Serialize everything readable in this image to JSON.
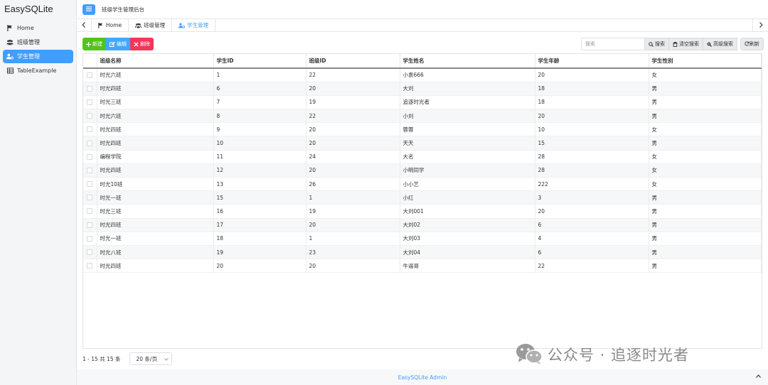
{
  "app": {
    "brand": "EasySQLite",
    "header_title": "班级学生管理后台",
    "footer": "EasySQLite Admin"
  },
  "sidebar": {
    "items": [
      {
        "label": "Home",
        "icon": "flag-icon",
        "active": false
      },
      {
        "label": "班级管理",
        "icon": "users-icon",
        "active": false
      },
      {
        "label": "学生管理",
        "icon": "user-gear-icon",
        "active": true
      },
      {
        "label": "TableExample",
        "icon": "table-icon",
        "active": false
      }
    ]
  },
  "tabs": [
    {
      "label": "Home",
      "icon": "flag-icon"
    },
    {
      "label": "班级管理",
      "icon": "users-icon"
    },
    {
      "label": "学生管理",
      "icon": "user-gear-icon",
      "active": true
    }
  ],
  "toolbar": {
    "add_label": "新建",
    "edit_label": "编辑",
    "delete_label": "删除",
    "search_placeholder": "搜索",
    "search_label": "搜索",
    "clear_label": "清空搜索",
    "advanced_label": "高级搜索",
    "refresh_label": "刷新"
  },
  "table": {
    "columns": [
      "班级名称",
      "学生ID",
      "班级ID",
      "学生姓名",
      "学生年龄",
      "学生性别"
    ],
    "rows": [
      [
        "时光六班",
        "1",
        "22",
        "小袁666",
        "20",
        "女"
      ],
      [
        "时光四班",
        "6",
        "20",
        "大刘",
        "18",
        "男"
      ],
      [
        "时光三班",
        "7",
        "19",
        "追逐时光者",
        "18",
        "男"
      ],
      [
        "时光六班",
        "8",
        "22",
        "小刘",
        "20",
        "男"
      ],
      [
        "时光四班",
        "9",
        "20",
        "蓉蓉",
        "10",
        "女"
      ],
      [
        "时光四班",
        "10",
        "20",
        "天天",
        "15",
        "男"
      ],
      [
        "编程学院",
        "11",
        "24",
        "大名",
        "28",
        "女"
      ],
      [
        "时光四班",
        "12",
        "20",
        "小明同学",
        "28",
        "女"
      ],
      [
        "时光10班",
        "13",
        "26",
        "小小艺",
        "222",
        "女"
      ],
      [
        "时光一班",
        "15",
        "1",
        "小红",
        "3",
        "男"
      ],
      [
        "时光三班",
        "16",
        "19",
        "大刘001",
        "20",
        "男"
      ],
      [
        "时光四班",
        "17",
        "20",
        "大刘02",
        "6",
        "男"
      ],
      [
        "时光一班",
        "18",
        "1",
        "大刘03",
        "4",
        "男"
      ],
      [
        "时光八班",
        "19",
        "23",
        "大刘04",
        "6",
        "男"
      ],
      [
        "时光四班",
        "20",
        "20",
        "牛逼哥",
        "22",
        "男"
      ]
    ]
  },
  "pagination": {
    "info": "1 - 15 共 15 条",
    "page_size": "20 条/页"
  },
  "watermark": {
    "text": "公众号 · 追逐时光者"
  },
  "colors": {
    "primary": "#409eff",
    "add": "#52c41a",
    "edit": "#40a9ff",
    "delete": "#f5365c"
  }
}
